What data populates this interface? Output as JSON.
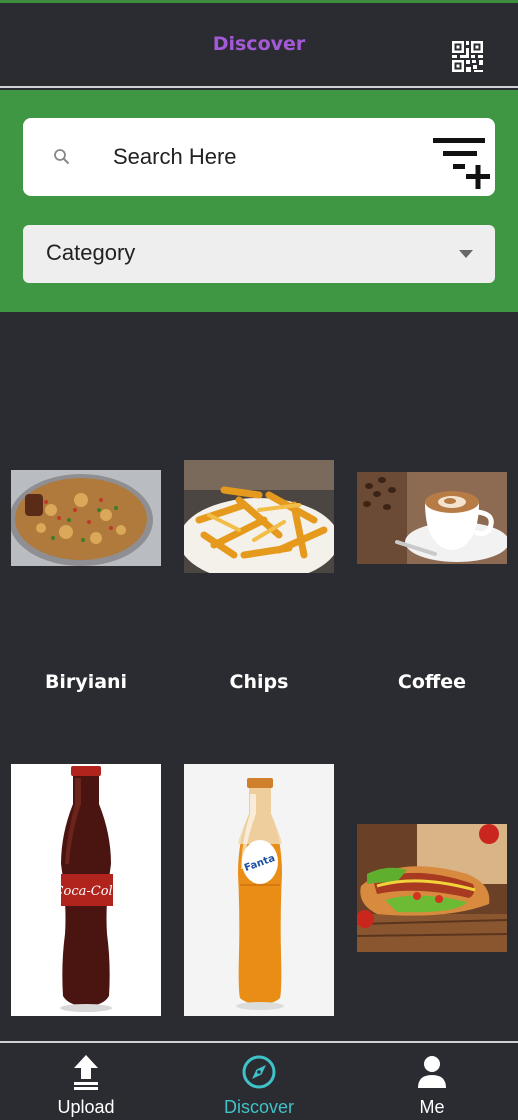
{
  "header": {
    "title": "Discover",
    "qr_icon": "qr-code-icon"
  },
  "search": {
    "placeholder": "Search Here",
    "icon": "search-icon",
    "filter_icon": "filter-add-icon"
  },
  "category": {
    "label": "Category",
    "icon": "chevron-down-icon"
  },
  "items": [
    {
      "label": "Biryiani",
      "image": "biryani-photo"
    },
    {
      "label": "Chips",
      "image": "fries-photo"
    },
    {
      "label": "Coffee",
      "image": "coffee-photo"
    },
    {
      "label": "",
      "image": "coca-cola-bottle-photo",
      "bottle_text": "Coca-Cola"
    },
    {
      "label": "",
      "image": "fanta-bottle-photo",
      "bottle_text": "Fanta"
    },
    {
      "label": "",
      "image": "hotdog-photo"
    }
  ],
  "nav": {
    "items": [
      {
        "label": "Upload",
        "icon": "upload-icon",
        "active": false
      },
      {
        "label": "Discover",
        "icon": "compass-icon",
        "active": true
      },
      {
        "label": "Me",
        "icon": "person-icon",
        "active": false
      }
    ]
  },
  "colors": {
    "background": "#2b2c31",
    "accent_green": "#3f9643",
    "title_purple": "#a45ad6",
    "active_teal": "#3fc2c8"
  }
}
